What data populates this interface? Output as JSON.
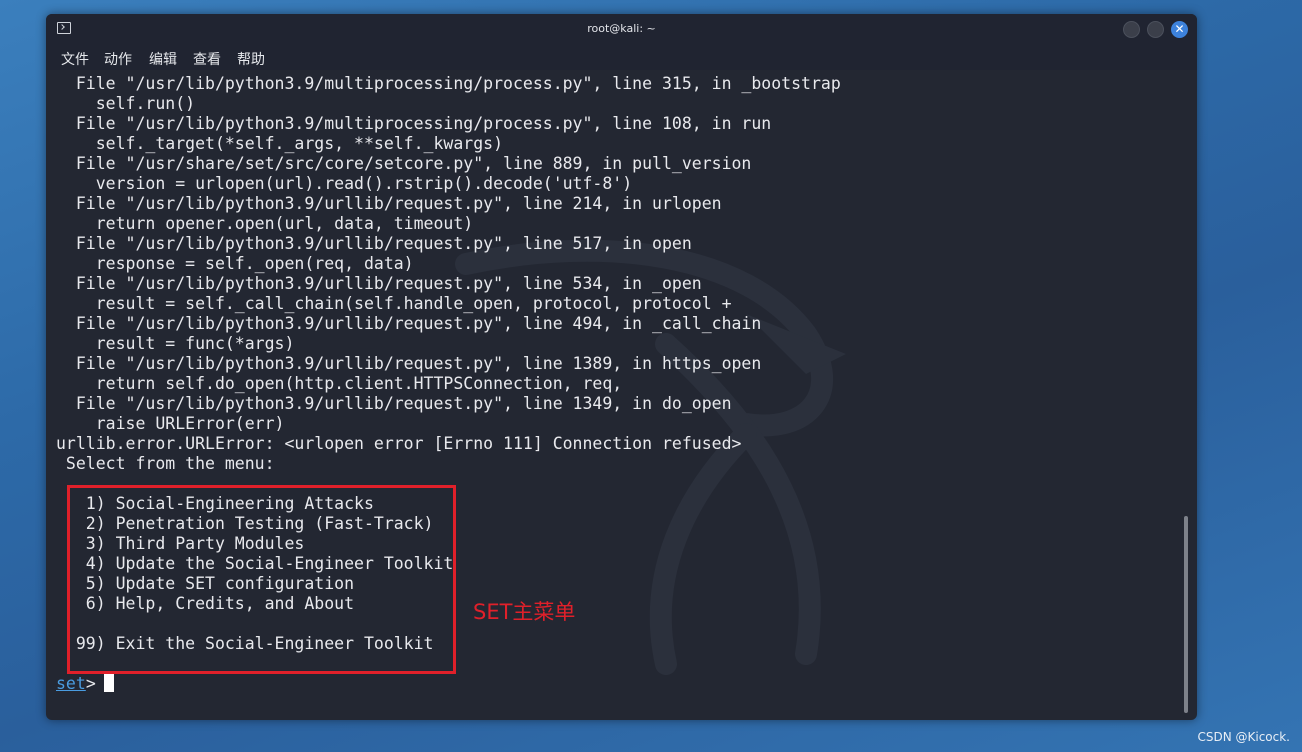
{
  "window": {
    "title": "root@kali: ~",
    "close_glyph": "✕"
  },
  "menu": [
    "文件",
    "动作",
    "编辑",
    "查看",
    "帮助"
  ],
  "terminal_lines": [
    "  File \"/usr/lib/python3.9/multiprocessing/process.py\", line 315, in _bootstrap",
    "    self.run()",
    "  File \"/usr/lib/python3.9/multiprocessing/process.py\", line 108, in run",
    "    self._target(*self._args, **self._kwargs)",
    "  File \"/usr/share/set/src/core/setcore.py\", line 889, in pull_version",
    "    version = urlopen(url).read().rstrip().decode('utf-8')",
    "  File \"/usr/lib/python3.9/urllib/request.py\", line 214, in urlopen",
    "    return opener.open(url, data, timeout)",
    "  File \"/usr/lib/python3.9/urllib/request.py\", line 517, in open",
    "    response = self._open(req, data)",
    "  File \"/usr/lib/python3.9/urllib/request.py\", line 534, in _open",
    "    result = self._call_chain(self.handle_open, protocol, protocol +",
    "  File \"/usr/lib/python3.9/urllib/request.py\", line 494, in _call_chain",
    "    result = func(*args)",
    "  File \"/usr/lib/python3.9/urllib/request.py\", line 1389, in https_open",
    "    return self.do_open(http.client.HTTPSConnection, req,",
    "  File \"/usr/lib/python3.9/urllib/request.py\", line 1349, in do_open",
    "    raise URLError(err)",
    "urllib.error.URLError: <urlopen error [Errno 111] Connection refused>",
    " Select from the menu:",
    "",
    "   1) Social-Engineering Attacks",
    "   2) Penetration Testing (Fast-Track)",
    "   3) Third Party Modules",
    "   4) Update the Social-Engineer Toolkit",
    "   5) Update SET configuration",
    "   6) Help, Credits, and About",
    "",
    "  99) Exit the Social-Engineer Toolkit",
    ""
  ],
  "prompt": {
    "name": "set",
    "symbol": ">"
  },
  "annotation": "SET主菜单",
  "watermark": "CSDN @Kicock.",
  "colors": {
    "annotation": "#e0202a",
    "prompt_link": "#4a9ce0",
    "close_button": "#3d82dc",
    "terminal_bg": "#232732"
  }
}
